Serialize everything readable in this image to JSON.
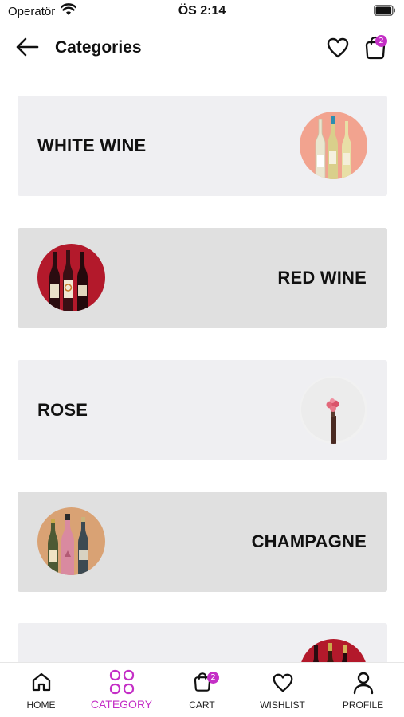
{
  "status_bar": {
    "carrier": "Operatör",
    "time": "ÖS 2:14"
  },
  "header": {
    "title": "Categories",
    "cart_badge": "2"
  },
  "categories": [
    {
      "label": "WHITE WINE"
    },
    {
      "label": "RED WINE"
    },
    {
      "label": "ROSE"
    },
    {
      "label": "CHAMPAGNE"
    },
    {
      "label": ""
    }
  ],
  "tab_bar": {
    "items": [
      {
        "label": "HOME",
        "icon": "home-icon"
      },
      {
        "label": "CATEGORY",
        "icon": "category-grid-icon",
        "active": true
      },
      {
        "label": "CART",
        "icon": "cart-icon",
        "badge": "2"
      },
      {
        "label": "WISHLIST",
        "icon": "heart-icon"
      },
      {
        "label": "PROFILE",
        "icon": "profile-icon"
      }
    ]
  },
  "colors": {
    "accent": "#c42fc6",
    "card_light": "#efeff2",
    "card_dark": "#e0e0e0"
  }
}
